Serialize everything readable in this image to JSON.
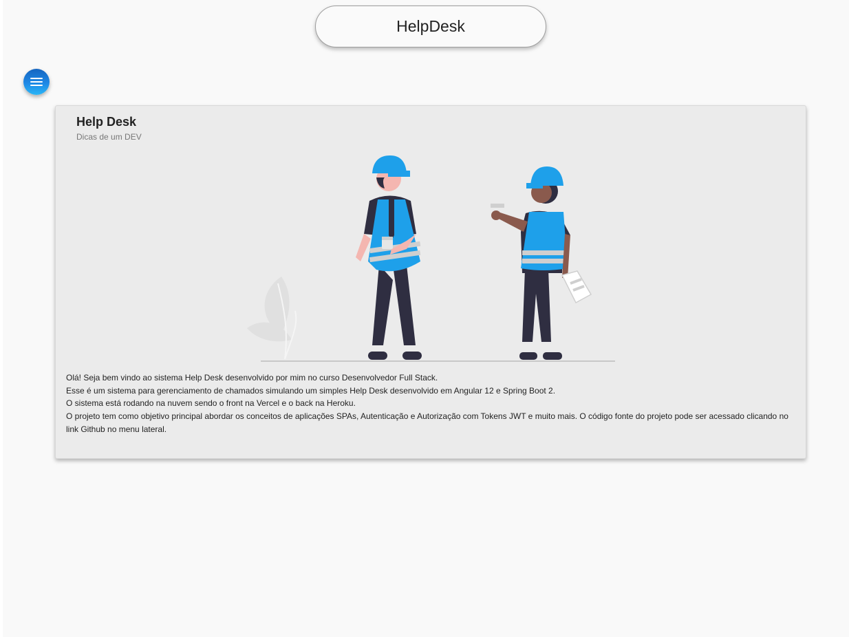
{
  "header": {
    "title": "HelpDesk"
  },
  "menu": {
    "icon": "menu-icon"
  },
  "card": {
    "title": "Help Desk",
    "subtitle": "Dicas de um DEV",
    "illustration": "two-workers-with-hard-hats",
    "paragraphs": [
      "Olá! Seja bem vindo ao sistema Help Desk desenvolvido por mim no curso Desenvolvedor Full Stack.",
      "Esse é um sistema para gerenciamento de chamados simulando um simples Help Desk desenvolvido em Angular 12 e Spring Boot 2.",
      "O sistema está rodando na nuvem sendo o front na Vercel e o back na Heroku.",
      "O projeto tem como objetivo principal abordar os conceitos de aplicações SPAs, Autenticação e Autorização com Tokens JWT e muito mais. O código fonte do projeto pode ser acessado clicando no link Github no menu lateral."
    ]
  },
  "colors": {
    "accent": "#1e88e5",
    "helmet": "#1ea0ea",
    "card_bg": "#ebebeb",
    "page_bg": "#f9f9f9"
  }
}
